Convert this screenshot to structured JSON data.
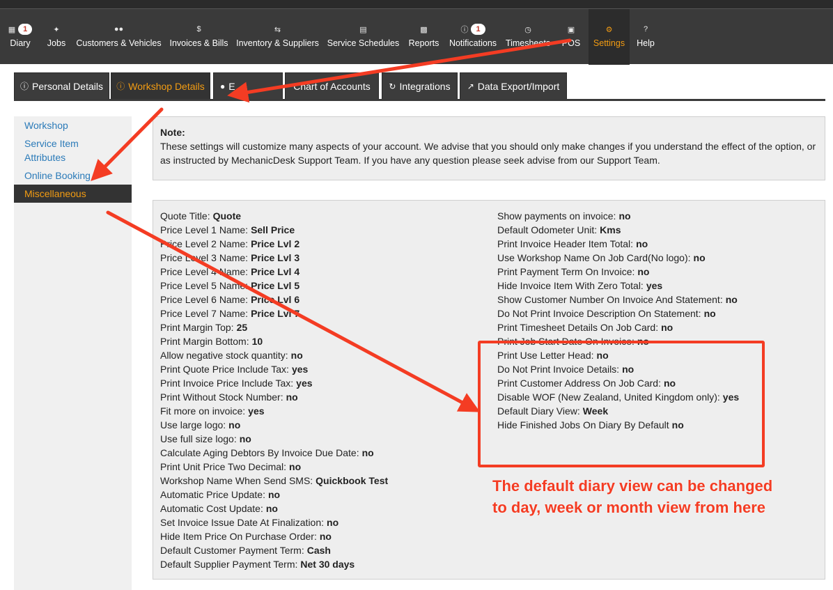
{
  "nav": {
    "items": [
      {
        "label": "Diary",
        "icon": "calendar-icon",
        "badge": "1"
      },
      {
        "label": "Jobs",
        "icon": "wrench-icon"
      },
      {
        "label": "Customers & Vehicles",
        "icon": "users-icon"
      },
      {
        "label": "Invoices & Bills",
        "icon": "dollar-icon"
      },
      {
        "label": "Inventory & Suppliers",
        "icon": "exchange-icon"
      },
      {
        "label": "Service Schedules",
        "icon": "calendar-icon"
      },
      {
        "label": "Reports",
        "icon": "bar-chart-icon"
      },
      {
        "label": "Notifications",
        "icon": "info-icon",
        "badge": "1"
      },
      {
        "label": "Timesheets",
        "icon": "clock-icon"
      },
      {
        "label": "POS",
        "icon": "money-icon"
      },
      {
        "label": "Settings",
        "icon": "gears-icon"
      },
      {
        "label": "Help",
        "icon": "question-icon"
      }
    ],
    "active_color": "#f39c12"
  },
  "tabs": [
    {
      "label": "Personal Details",
      "icon": "info-icon"
    },
    {
      "label": "Workshop Details",
      "icon": "info-icon"
    },
    {
      "label": "E",
      "icon": "user-icon"
    },
    {
      "label": "Chart of Accounts",
      "icon": ""
    },
    {
      "label": "Integrations",
      "icon": "refresh-icon"
    },
    {
      "label": "Data Export/Import",
      "icon": "share-icon"
    }
  ],
  "sidebar": {
    "items": [
      "Workshop",
      "Service Item Attributes",
      "Online Booking",
      "Miscellaneous"
    ]
  },
  "note": {
    "title": "Note:",
    "body": "These settings will customize many aspects of your account. We advise that you should only make changes if you understand the effect of the option, or as instructed by MechanicDesk Support Team. If you have any question please seek advise from our Support Team."
  },
  "settings_left": [
    {
      "label": "Quote Title:",
      "value": "Quote"
    },
    {
      "label": "Price Level 1 Name:",
      "value": "Sell Price"
    },
    {
      "label": "Price Level 2 Name:",
      "value": "Price Lvl 2"
    },
    {
      "label": "Price Level 3 Name:",
      "value": "Price Lvl 3"
    },
    {
      "label": "Price Level 4 Name:",
      "value": "Price Lvl 4"
    },
    {
      "label": "Price Level 5 Name:",
      "value": "Price Lvl 5"
    },
    {
      "label": "Price Level 6 Name:",
      "value": "Price Lvl 6"
    },
    {
      "label": "Price Level 7 Name:",
      "value": "Price Lvl 7"
    },
    {
      "label": "Print Margin Top:",
      "value": "25"
    },
    {
      "label": "Print Margin Bottom:",
      "value": "10"
    },
    {
      "label": "Allow negative stock quantity:",
      "value": "no"
    },
    {
      "label": "Print Quote Price Include Tax:",
      "value": "yes"
    },
    {
      "label": "Print Invoice Price Include Tax:",
      "value": "yes"
    },
    {
      "label": "Print Without Stock Number:",
      "value": "no"
    },
    {
      "label": "Fit more on invoice:",
      "value": "yes"
    },
    {
      "label": "Use large logo:",
      "value": "no"
    },
    {
      "label": "Use full size logo:",
      "value": "no"
    },
    {
      "label": "Calculate Aging Debtors By Invoice Due Date:",
      "value": "no"
    },
    {
      "label": "Print Unit Price Two Decimal:",
      "value": "no"
    },
    {
      "label": "Workshop Name When Send SMS:",
      "value": "Quickbook Test"
    },
    {
      "label": "Automatic Price Update:",
      "value": "no"
    },
    {
      "label": "Automatic Cost Update:",
      "value": "no"
    },
    {
      "label": "Set Invoice Issue Date At Finalization:",
      "value": "no"
    },
    {
      "label": "Hide Item Price On Purchase Order:",
      "value": "no"
    },
    {
      "label": "Default Customer Payment Term:",
      "value": "Cash"
    },
    {
      "label": "Default Supplier Payment Term:",
      "value": "Net 30 days"
    }
  ],
  "settings_right": [
    {
      "label": "Show payments on invoice:",
      "value": "no"
    },
    {
      "label": "Default Odometer Unit:",
      "value": "Kms"
    },
    {
      "label": "Print Invoice Header Item Total:",
      "value": "no"
    },
    {
      "label": "Use Workshop Name On Job Card(No logo):",
      "value": "no"
    },
    {
      "label": "Print Payment Term On Invoice:",
      "value": "no"
    },
    {
      "label": "Hide Invoice Item With Zero Total:",
      "value": "yes"
    },
    {
      "label": "Show Customer Number On Invoice And Statement:",
      "value": "no"
    },
    {
      "label": "Do Not Print Invoice Description On Statement:",
      "value": "no"
    },
    {
      "label": "Print Timesheet Details On Job Card:",
      "value": "no"
    },
    {
      "label": "Print Job Start Date On Invoice:",
      "value": "no"
    },
    {
      "label": "Print Use Letter Head:",
      "value": "no"
    },
    {
      "label": "Do Not Print Invoice Details:",
      "value": "no"
    },
    {
      "label": "Print Customer Address On Job Card:",
      "value": "no"
    },
    {
      "label": "Disable WOF (New Zealand, United Kingdom only):",
      "value": "yes"
    },
    {
      "label": "Default Diary View:",
      "value": "Week"
    },
    {
      "label": "Hide Finished Jobs On Diary By Default",
      "value": "no"
    }
  ],
  "annotation": {
    "line1": "The default diary view can be changed",
    "line2": "to day, week or month view from here",
    "color": "#f43c23"
  }
}
